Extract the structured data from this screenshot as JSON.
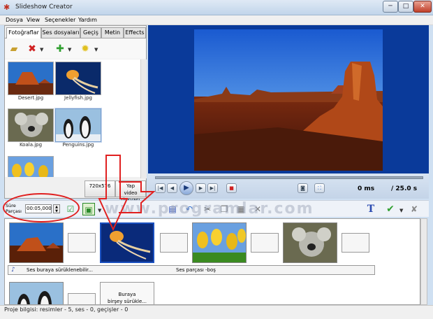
{
  "window": {
    "title": "Slideshow Creator",
    "min": "─",
    "max": "□",
    "close": "✕"
  },
  "menu": [
    "Dosya",
    "View",
    "Seçenekler",
    "Yardım"
  ],
  "tabs": [
    "Fotoğraflar",
    "Ses dosyaları",
    "Geçiş",
    "Metin",
    "Effects"
  ],
  "thumbnails": [
    {
      "label": "Desert.jpg"
    },
    {
      "label": "Jellyfish.jpg"
    },
    {
      "label": "Koala.jpg"
    },
    {
      "label": "Penguins.jpg"
    }
  ],
  "left_buttons": {
    "resolution": "720x576",
    "create_line1": "Yap",
    "create_line2": "video dosyası"
  },
  "playback": {
    "current": "0 ms",
    "total": "/ 25.0 s"
  },
  "duration": {
    "label_line1": "Süre",
    "label_line2": "Parçası",
    "value": "00:05,000"
  },
  "watermark": "www.programlar.com",
  "audio_track": {
    "left_text": "Ses buraya sürüklenebilir...",
    "center_text": "Ses parçası -boş"
  },
  "drop_hint": {
    "line1": "Buraya",
    "line2": "birşey sürükle..."
  },
  "status": "Proje bilgisi: resimler - 5, ses - 0, geçişler - 0",
  "colors": {
    "preview_bg": "#0a3a9a",
    "annotation": "#e02020",
    "selection": "#1a50c0"
  }
}
